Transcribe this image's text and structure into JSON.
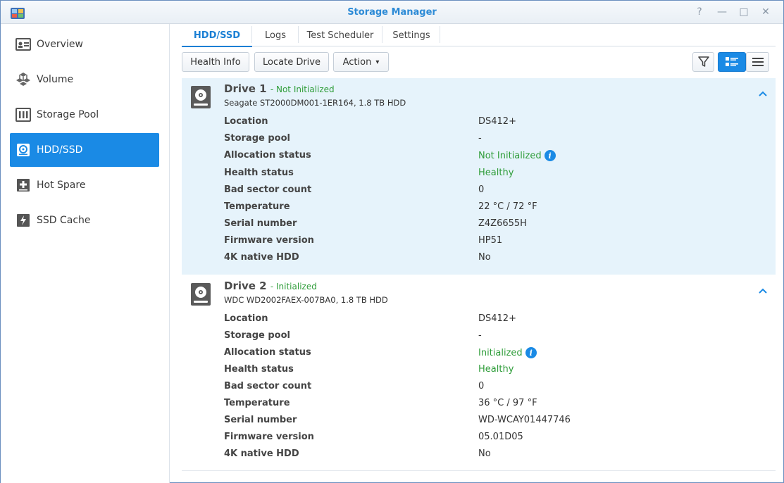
{
  "window": {
    "title": "Storage Manager",
    "controls": {
      "help": "?",
      "minimize": "—",
      "maximize": "□",
      "close": "✕"
    }
  },
  "sidebar": {
    "items": [
      {
        "label": "Overview",
        "icon": "overview-icon"
      },
      {
        "label": "Volume",
        "icon": "volume-icon"
      },
      {
        "label": "Storage Pool",
        "icon": "storage-pool-icon"
      },
      {
        "label": "HDD/SSD",
        "icon": "hdd-icon",
        "active": true
      },
      {
        "label": "Hot Spare",
        "icon": "hot-spare-icon"
      },
      {
        "label": "SSD Cache",
        "icon": "ssd-cache-icon"
      }
    ]
  },
  "tabs": [
    {
      "label": "HDD/SSD",
      "active": true
    },
    {
      "label": "Logs"
    },
    {
      "label": "Test Scheduler"
    },
    {
      "label": "Settings"
    }
  ],
  "toolbar": {
    "health_info": "Health Info",
    "locate_drive": "Locate Drive",
    "action": "Action",
    "action_caret": "▾"
  },
  "drives": [
    {
      "name": "Drive 1",
      "status": "- Not Initialized",
      "model": "Seagate ST2000DM001-1ER164, 1.8 TB HDD",
      "fields": [
        {
          "label": "Location",
          "value": "DS412+"
        },
        {
          "label": "Storage pool",
          "value": "-"
        },
        {
          "label": "Allocation status",
          "value": "Not Initialized",
          "status": "green",
          "info": true
        },
        {
          "label": "Health status",
          "value": "Healthy",
          "status": "green"
        },
        {
          "label": "Bad sector count",
          "value": "0"
        },
        {
          "label": "Temperature",
          "value": "22 °C / 72 °F"
        },
        {
          "label": "Serial number",
          "value": "Z4Z6655H"
        },
        {
          "label": "Firmware version",
          "value": "HP51"
        },
        {
          "label": "4K native HDD",
          "value": "No"
        }
      ]
    },
    {
      "name": "Drive 2",
      "status": "- Initialized",
      "model": "WDC WD2002FAEX-007BA0, 1.8 TB HDD",
      "fields": [
        {
          "label": "Location",
          "value": "DS412+"
        },
        {
          "label": "Storage pool",
          "value": "-"
        },
        {
          "label": "Allocation status",
          "value": "Initialized",
          "status": "green",
          "info": true
        },
        {
          "label": "Health status",
          "value": "Healthy",
          "status": "green"
        },
        {
          "label": "Bad sector count",
          "value": "0"
        },
        {
          "label": "Temperature",
          "value": "36 °C / 97 °F"
        },
        {
          "label": "Serial number",
          "value": "WD-WCAY01447746"
        },
        {
          "label": "Firmware version",
          "value": "05.01D05"
        },
        {
          "label": "4K native HDD",
          "value": "No"
        }
      ]
    }
  ],
  "colors": {
    "accent": "#1a8ae5",
    "status_green": "#2f9d3a",
    "selected_bg": "#e6f3fb",
    "title_blue": "#2d8bd6"
  },
  "info_glyph": "i"
}
